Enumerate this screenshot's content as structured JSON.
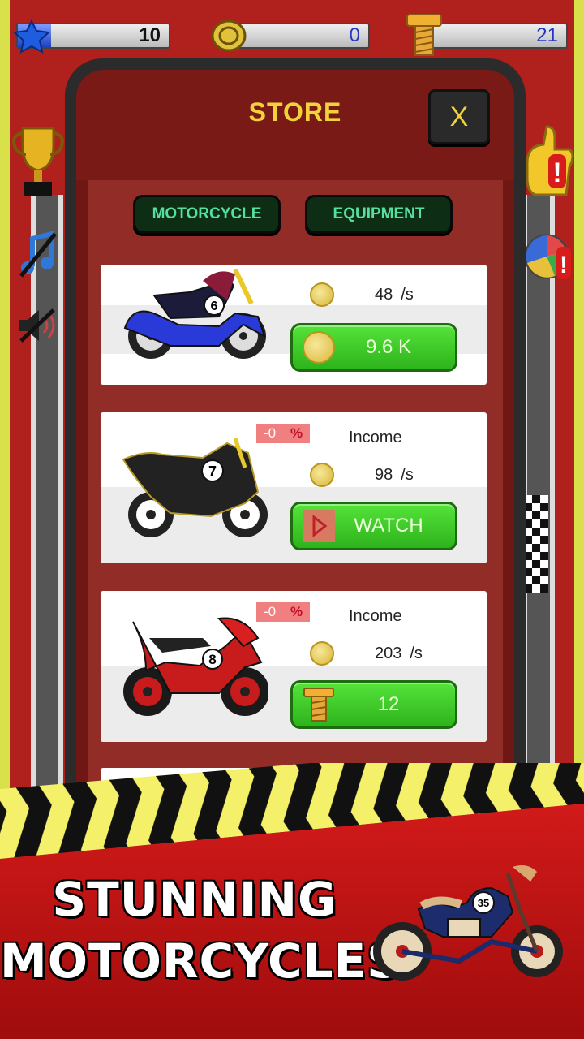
{
  "top_bar": {
    "level": "10",
    "coins": "0",
    "bolts": "21",
    "level_progress": 0.22
  },
  "store": {
    "title": "STORE",
    "close_label": "X",
    "tabs": [
      {
        "label": "MOTORCYCLE"
      },
      {
        "label": "EQUIPMENT"
      }
    ],
    "items": [
      {
        "number": "6",
        "rate_value": "48",
        "rate_unit": "/s",
        "button_label": "9.6 K",
        "button_icon": "coin-icon"
      },
      {
        "number": "7",
        "discount": "-0",
        "income_label": "Income",
        "rate_value": "98",
        "rate_unit": "/s",
        "button_label": "WATCH",
        "button_icon": "play-icon"
      },
      {
        "number": "8",
        "discount": "-0",
        "income_label": "Income",
        "rate_value": "203",
        "rate_unit": "/s",
        "button_label": "12",
        "button_icon": "bolt-icon"
      }
    ]
  },
  "banner": {
    "line1": "STUNNING",
    "line2": "MOTORCYCLES",
    "bike_number": "35"
  },
  "colors": {
    "background_red": "#b0201c",
    "panel_dark": "#2b2b2b",
    "title_yellow": "#f2d23a",
    "button_green": "#2eb31c",
    "tab_text": "#55e0a0"
  }
}
